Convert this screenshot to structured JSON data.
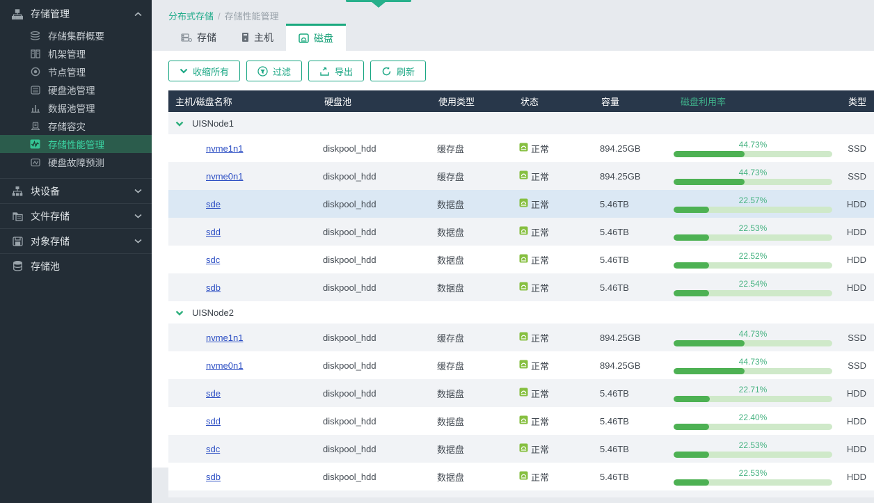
{
  "colors": {
    "accent_green": "#1ba784",
    "sidebar_bg": "#232d36",
    "sidebar_active_bg": "#2b5c4c",
    "sidebar_active_text": "#3bd3a2",
    "table_header_bg": "#28374a",
    "util_header_green": "#3fb08a",
    "bar_fill": "#4db153",
    "bar_track": "#cfe9c9",
    "status_icon_green": "#86bf40",
    "link_blue": "#2d4fc4",
    "row_stripe": "#f1f3f6",
    "row_highlight": "#dbe8f4"
  },
  "breadcrumb": {
    "root": "分布式存储",
    "separator": "/",
    "current": "存储性能管理"
  },
  "sidebar": {
    "group1": {
      "label": "存储管理",
      "chevron": "up"
    },
    "group1_items": [
      {
        "label": "存储集群概要"
      },
      {
        "label": "机架管理"
      },
      {
        "label": "节点管理"
      },
      {
        "label": "硬盘池管理"
      },
      {
        "label": "数据池管理"
      },
      {
        "label": "存储容灾"
      },
      {
        "label": "存储性能管理",
        "active": true
      },
      {
        "label": "硬盘故障预测"
      }
    ],
    "group2": {
      "label": "块设备",
      "chevron": "down"
    },
    "group3": {
      "label": "文件存储",
      "chevron": "down"
    },
    "group4": {
      "label": "对象存储",
      "chevron": "down"
    },
    "group5": {
      "label": "存储池"
    }
  },
  "tabs": [
    {
      "label": "存储",
      "active": false
    },
    {
      "label": "主机",
      "active": false
    },
    {
      "label": "磁盘",
      "active": true
    }
  ],
  "toolbar": {
    "collapse_all": "收缩所有",
    "filter": "过滤",
    "export": "导出",
    "refresh": "刷新"
  },
  "table": {
    "headers": [
      "主机/磁盘名称",
      "硬盘池",
      "使用类型",
      "状态",
      "容量",
      "磁盘利用率",
      "类型"
    ],
    "groups": [
      {
        "name": "UISNode1",
        "disks": [
          {
            "name": "nvme1n1",
            "pool": "diskpool_hdd",
            "use": "缓存盘",
            "status": "正常",
            "capacity": "894.25GB",
            "util": 44.73,
            "util_label": "44.73%",
            "type": "SSD"
          },
          {
            "name": "nvme0n1",
            "pool": "diskpool_hdd",
            "use": "缓存盘",
            "status": "正常",
            "capacity": "894.25GB",
            "util": 44.73,
            "util_label": "44.73%",
            "type": "SSD"
          },
          {
            "name": "sde",
            "pool": "diskpool_hdd",
            "use": "数据盘",
            "status": "正常",
            "capacity": "5.46TB",
            "util": 22.57,
            "util_label": "22.57%",
            "type": "HDD",
            "highlighted": true
          },
          {
            "name": "sdd",
            "pool": "diskpool_hdd",
            "use": "数据盘",
            "status": "正常",
            "capacity": "5.46TB",
            "util": 22.53,
            "util_label": "22.53%",
            "type": "HDD"
          },
          {
            "name": "sdc",
            "pool": "diskpool_hdd",
            "use": "数据盘",
            "status": "正常",
            "capacity": "5.46TB",
            "util": 22.52,
            "util_label": "22.52%",
            "type": "HDD"
          },
          {
            "name": "sdb",
            "pool": "diskpool_hdd",
            "use": "数据盘",
            "status": "正常",
            "capacity": "5.46TB",
            "util": 22.54,
            "util_label": "22.54%",
            "type": "HDD"
          }
        ]
      },
      {
        "name": "UISNode2",
        "disks": [
          {
            "name": "nvme1n1",
            "pool": "diskpool_hdd",
            "use": "缓存盘",
            "status": "正常",
            "capacity": "894.25GB",
            "util": 44.73,
            "util_label": "44.73%",
            "type": "SSD"
          },
          {
            "name": "nvme0n1",
            "pool": "diskpool_hdd",
            "use": "缓存盘",
            "status": "正常",
            "capacity": "894.25GB",
            "util": 44.73,
            "util_label": "44.73%",
            "type": "SSD"
          },
          {
            "name": "sde",
            "pool": "diskpool_hdd",
            "use": "数据盘",
            "status": "正常",
            "capacity": "5.46TB",
            "util": 22.71,
            "util_label": "22.71%",
            "type": "HDD"
          },
          {
            "name": "sdd",
            "pool": "diskpool_hdd",
            "use": "数据盘",
            "status": "正常",
            "capacity": "5.46TB",
            "util": 22.4,
            "util_label": "22.40%",
            "type": "HDD"
          },
          {
            "name": "sdc",
            "pool": "diskpool_hdd",
            "use": "数据盘",
            "status": "正常",
            "capacity": "5.46TB",
            "util": 22.53,
            "util_label": "22.53%",
            "type": "HDD"
          },
          {
            "name": "sdb",
            "pool": "diskpool_hdd",
            "use": "数据盘",
            "status": "正常",
            "capacity": "5.46TB",
            "util": 22.53,
            "util_label": "22.53%",
            "type": "HDD"
          }
        ]
      }
    ]
  }
}
